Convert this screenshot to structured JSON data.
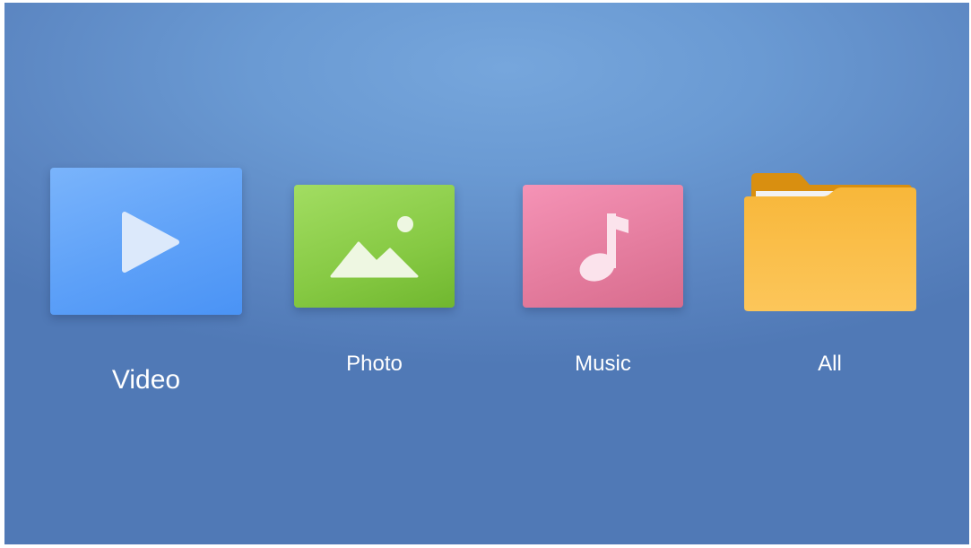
{
  "menu": {
    "items": [
      {
        "label": "Video",
        "icon": "play-icon",
        "color": "#5ea1f8",
        "focused": true
      },
      {
        "label": "Photo",
        "icon": "image-icon",
        "color": "#86c943",
        "focused": false
      },
      {
        "label": "Music",
        "icon": "music-note-icon",
        "color": "#e57d9f",
        "focused": false
      },
      {
        "label": "All",
        "icon": "folder-icon",
        "color": "#f6b233",
        "focused": false
      }
    ]
  },
  "theme": {
    "background": "#6a9ad3"
  }
}
